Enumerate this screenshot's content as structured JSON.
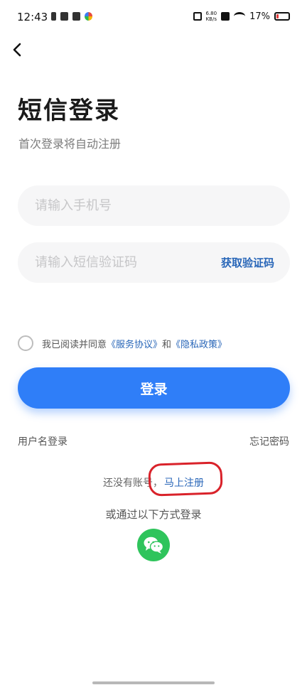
{
  "status_bar": {
    "time": "12:43",
    "net_speed": "6.80",
    "net_unit": "KB/s",
    "battery": "17%",
    "battery_level": 0.17,
    "battery_color": "#e23a3a"
  },
  "header": {
    "back_icon": "chevron-left-icon"
  },
  "page": {
    "title": "短信登录",
    "subtitle": "首次登录将自动注册"
  },
  "form": {
    "phone_placeholder": "请输入手机号",
    "code_placeholder": "请输入短信验证码",
    "get_code_label": "获取验证码"
  },
  "agreement": {
    "prefix": "我已阅读并同意",
    "service_link": "《服务协议》",
    "and": "和",
    "privacy_link": "《隐私政策》",
    "checked": false
  },
  "actions": {
    "login_label": "登录",
    "username_login": "用户名登录",
    "forgot_password": "忘记密码",
    "no_account": "还没有账号，",
    "register_now": "马上注册",
    "other_login": "或通过以下方式登录",
    "wechat_icon": "wechat-icon"
  },
  "colors": {
    "accent": "#2f7ef8",
    "link": "#2866b8",
    "wechat": "#2fc45c",
    "annotation": "#d9222a"
  }
}
